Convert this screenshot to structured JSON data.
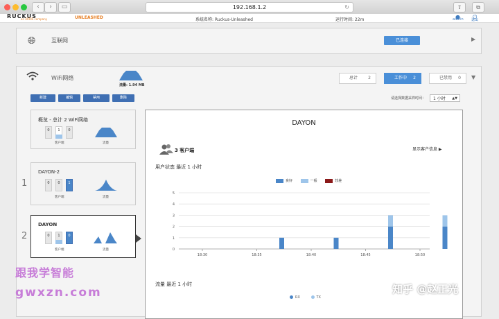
{
  "browser": {
    "url": "192.168.1.2",
    "reload_glyph": "↻"
  },
  "header": {
    "logo": "RUCKUS",
    "logo_sub": "an ARRIS company",
    "product": "UNLEASHED",
    "system_name": "系统名称: Ruckus-Unleashed",
    "uptime": "运行时间: 22m",
    "user": "admin",
    "logout": "退出"
  },
  "internet": {
    "label": "互联网",
    "status": "已连接"
  },
  "wifi": {
    "label": "WiFi网络",
    "traffic_label": "流量: 1.94 MB",
    "tabs": [
      {
        "label": "总计",
        "count": "2"
      },
      {
        "label": "工作中",
        "count": "2"
      },
      {
        "label": "已禁用",
        "count": "0"
      }
    ],
    "actions": [
      "新建",
      "编辑",
      "禁用",
      "删除"
    ],
    "range_label": "请选择数据采样时间：",
    "range_value": "1 小时",
    "cards": [
      {
        "title": "概览 - 总计 2 WiFi网络",
        "row": "",
        "boxes": [
          "0",
          "1",
          "0"
        ],
        "clients_label": "客户端",
        "traffic_label": "流量"
      },
      {
        "title": "DAYON-2",
        "row": "1",
        "boxes": [
          "0",
          "0",
          "1"
        ],
        "clients_label": "客户端",
        "traffic_label": "流量"
      },
      {
        "title": "DAYON",
        "row": "2",
        "boxes": [
          "0",
          "1",
          "0"
        ],
        "clients_label": "客户端",
        "traffic_label": "流量"
      }
    ]
  },
  "detail": {
    "title": "DAYON",
    "clients": "3 客户端",
    "show_info": "显示客户信息",
    "user_state_title": "用户状态",
    "user_state_period": "最近 1 小时",
    "traffic_title": "流量",
    "traffic_period": "最近 1 小时",
    "legend": [
      {
        "name": "良好",
        "color": "#4a86c8"
      },
      {
        "name": "一般",
        "color": "#9ec5ea"
      },
      {
        "name": "较差",
        "color": "#8b1a1a"
      }
    ],
    "traffic_legend": [
      {
        "name": "RX",
        "color": "#4a86c8"
      },
      {
        "name": "TX",
        "color": "#9ec5ea"
      }
    ]
  },
  "chart_data": {
    "type": "bar",
    "stacked": true,
    "x_ticks": [
      "18:30",
      "18:35",
      "18:40",
      "18:45",
      "18:50"
    ],
    "ylim": [
      0,
      5
    ],
    "y_ticks": [
      "0",
      "1",
      "2",
      "3",
      "4",
      "5"
    ],
    "bars": [
      {
        "x": "18:35",
        "values": {
          "良好": 1,
          "一般": 0
        }
      },
      {
        "x": "18:40",
        "values": {
          "良好": 1,
          "一般": 0
        }
      },
      {
        "x": "18:45",
        "values": {
          "良好": 2,
          "一般": 1
        }
      },
      {
        "x": "18:50",
        "values": {
          "良好": 2,
          "一般": 1
        }
      }
    ]
  },
  "watermarks": {
    "left_top": "跟我学智能",
    "left_bottom": "gwxzn.com",
    "right": "知乎 @赵正光"
  }
}
